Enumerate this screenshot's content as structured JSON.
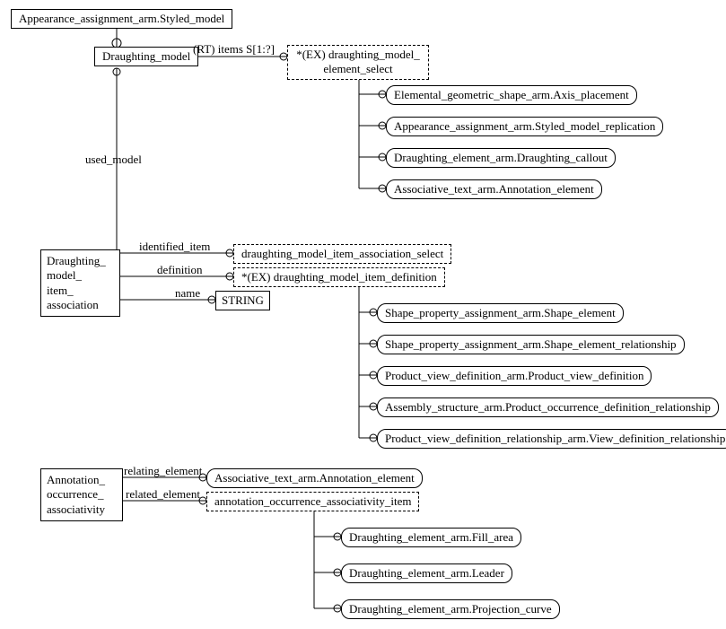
{
  "top_entity": "Appearance_assignment_arm.Styled_model",
  "draughting_model": "Draughting_model",
  "attr_items": "(RT) items S[1:?]",
  "select_dm_element": "*(EX) draughting_model_\nelement_select",
  "dm_element_types": [
    "Elemental_geometric_shape_arm.Axis_placement",
    "Appearance_assignment_arm.Styled_model_replication",
    "Draughting_element_arm.Draughting_callout",
    "Associative_text_arm.Annotation_element"
  ],
  "used_model_label": "used_model",
  "dmia_entity": "Draughting_\nmodel_\nitem_\nassociation",
  "dmia_attrs": {
    "identified_item": "identified_item",
    "definition": "definition",
    "name": "name"
  },
  "select_dmia_select": "draughting_model_item_association_select",
  "select_dmia_def": "*(EX) draughting_model_item_definition",
  "string_type": "STRING",
  "dmia_def_types": [
    "Shape_property_assignment_arm.Shape_element",
    "Shape_property_assignment_arm.Shape_element_relationship",
    "Product_view_definition_arm.Product_view_definition",
    "Assembly_structure_arm.Product_occurrence_definition_relationship",
    "Product_view_definition_relationship_arm.View_definition_relationship"
  ],
  "aoa_entity": "Annotation_\noccurrence_\nassociativity",
  "aoa_attrs": {
    "relating": "relating_element",
    "related": "related_element"
  },
  "aoa_relating_type": "Associative_text_arm.Annotation_element",
  "select_aoa_item": "annotation_occurrence_associativity_item",
  "aoa_item_types": [
    "Draughting_element_arm.Fill_area",
    "Draughting_element_arm.Leader",
    "Draughting_element_arm.Projection_curve"
  ]
}
